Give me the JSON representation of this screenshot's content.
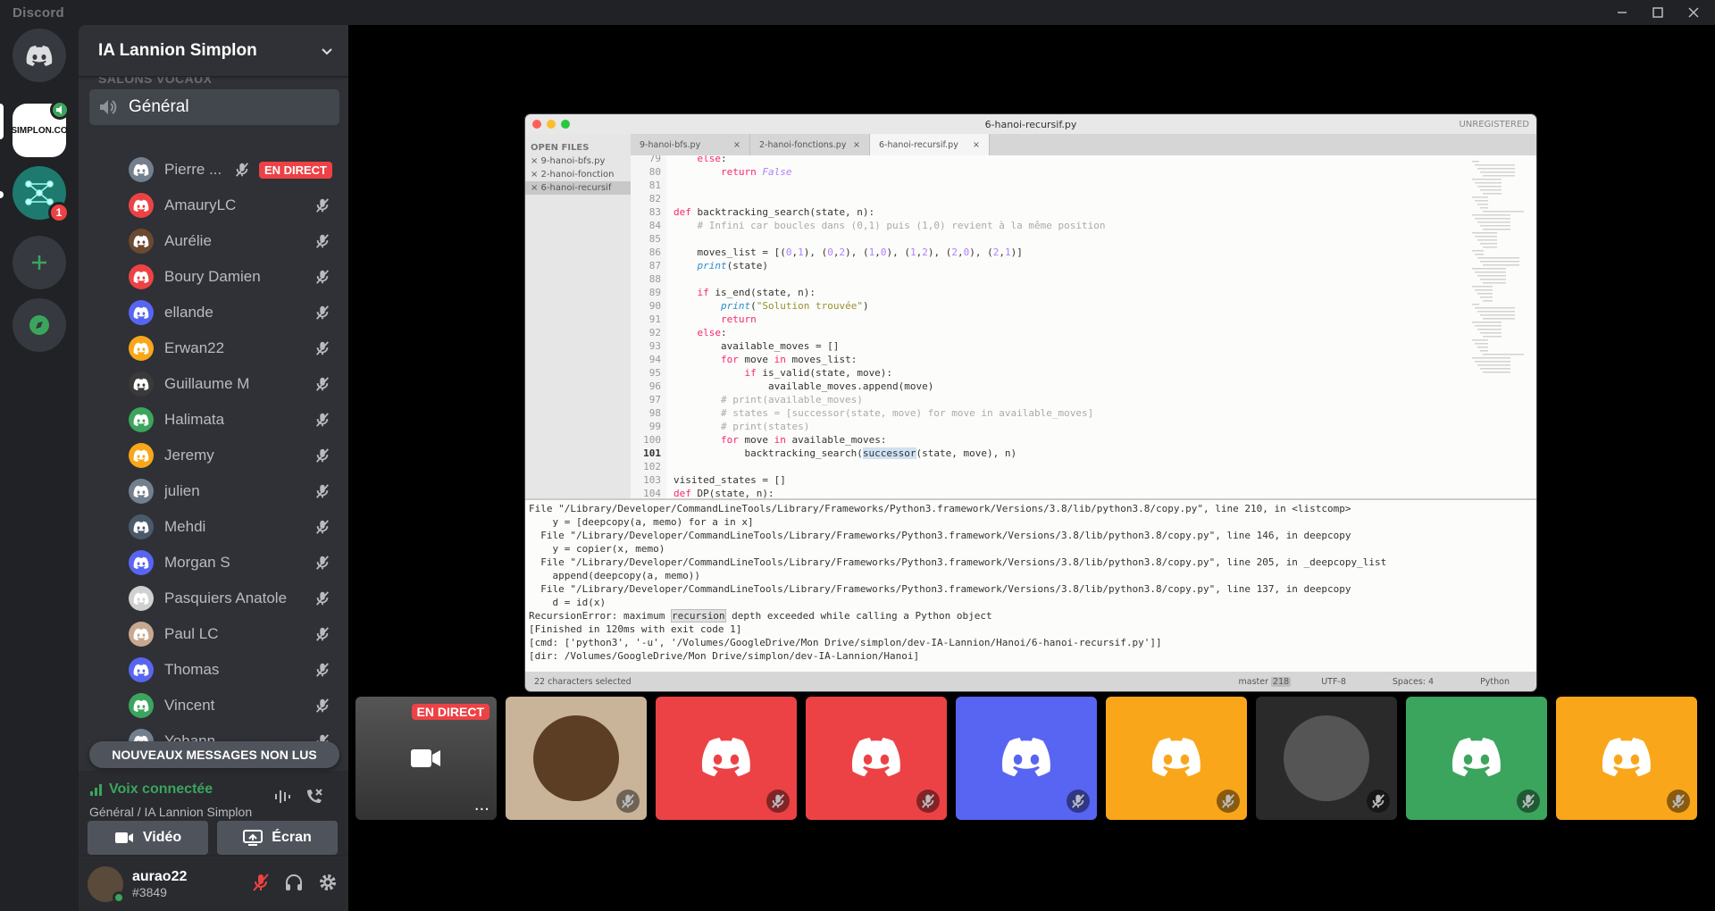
{
  "app": {
    "title": "Discord"
  },
  "server": {
    "name": "IA Lannion Simplon",
    "category": "SALONS VOCAUX"
  },
  "voice_channel": {
    "name": "Général"
  },
  "members": [
    {
      "name": "Pierre ...",
      "color": "#747f8d",
      "live": true
    },
    {
      "name": "AmauryLC",
      "color": "#ed4245"
    },
    {
      "name": "Aurélie",
      "color": "#6b4a30"
    },
    {
      "name": "Boury Damien",
      "color": "#ed4245"
    },
    {
      "name": "ellande",
      "color": "#5865f2"
    },
    {
      "name": "Erwan22",
      "color": "#faa61a"
    },
    {
      "name": "Guillaume M",
      "color": "#3a3a3a"
    },
    {
      "name": "Halimata",
      "color": "#3ba55d"
    },
    {
      "name": "Jeremy",
      "color": "#faa61a"
    },
    {
      "name": "julien",
      "color": "#747f8d"
    },
    {
      "name": "Mehdi",
      "color": "#4a5a6a"
    },
    {
      "name": "Morgan S",
      "color": "#5865f2"
    },
    {
      "name": "Pasquiers Anatole",
      "color": "#d0d0d0"
    },
    {
      "name": "Paul LC",
      "color": "#c8a890"
    },
    {
      "name": "Thomas",
      "color": "#5865f2"
    },
    {
      "name": "Vincent",
      "color": "#3ba55d"
    },
    {
      "name": "Yohann",
      "color": "#747f8d"
    }
  ],
  "live_label": "EN DIRECT",
  "unread_banner": "NOUVEAUX MESSAGES NON LUS",
  "voice_status": {
    "title": "Voix connectée",
    "subtitle": "Général / IA Lannion Simplon",
    "video_label": "Vidéo",
    "screen_label": "Écran"
  },
  "user": {
    "name": "aurao22",
    "tag": "#3849"
  },
  "guild_badge": "1",
  "simplon_label": "SIMPLON.CO",
  "editor": {
    "filename": "6-hanoi-recursif.py",
    "unregistered": "UNREGISTERED",
    "open_files_label": "OPEN FILES",
    "open_files": [
      "9-hanoi-bfs.py",
      "2-hanoi-fonction",
      "6-hanoi-recursif"
    ],
    "tabs": [
      "9-hanoi-bfs.py",
      "2-hanoi-fonctions.py",
      "6-hanoi-recursif.py"
    ],
    "lines": [
      {
        "n": "79",
        "t": "    else:"
      },
      {
        "n": "80",
        "t": "        return False"
      },
      {
        "n": "81",
        "t": ""
      },
      {
        "n": "82",
        "t": ""
      },
      {
        "n": "83",
        "t": "def backtracking_search(state, n):"
      },
      {
        "n": "84",
        "t": "    # Infini car boucles dans (0,1) puis (1,0) revient à la même position"
      },
      {
        "n": "85",
        "t": ""
      },
      {
        "n": "86",
        "t": "    moves_list = [(0,1), (0,2), (1,0), (1,2), (2,0), (2,1)]"
      },
      {
        "n": "87",
        "t": "    print(state)"
      },
      {
        "n": "88",
        "t": ""
      },
      {
        "n": "89",
        "t": "    if is_end(state, n):"
      },
      {
        "n": "90",
        "t": "        print(\"Solution trouvée\")"
      },
      {
        "n": "91",
        "t": "        return"
      },
      {
        "n": "92",
        "t": "    else:"
      },
      {
        "n": "93",
        "t": "        available_moves = []"
      },
      {
        "n": "94",
        "t": "        for move in moves_list:"
      },
      {
        "n": "95",
        "t": "            if is_valid(state, move):"
      },
      {
        "n": "96",
        "t": "                available_moves.append(move)"
      },
      {
        "n": "97",
        "t": "        # print(available_moves)"
      },
      {
        "n": "98",
        "t": "        # states = [successor(state, move) for move in available_moves]"
      },
      {
        "n": "99",
        "t": "        # print(states)"
      },
      {
        "n": "100",
        "t": "        for move in available_moves:"
      },
      {
        "n": "101",
        "t": "            backtracking_search(successor(state, move), n)"
      },
      {
        "n": "102",
        "t": ""
      },
      {
        "n": "103",
        "t": "visited_states = []"
      },
      {
        "n": "104",
        "t": "def DP(state, n):"
      }
    ],
    "console": [
      "File \"/Library/Developer/CommandLineTools/Library/Frameworks/Python3.framework/Versions/3.8/lib/python3.8/copy.py\", line 210, in <listcomp>",
      "    y = [deepcopy(a, memo) for a in x]",
      "  File \"/Library/Developer/CommandLineTools/Library/Frameworks/Python3.framework/Versions/3.8/lib/python3.8/copy.py\", line 146, in deepcopy",
      "    y = copier(x, memo)",
      "  File \"/Library/Developer/CommandLineTools/Library/Frameworks/Python3.framework/Versions/3.8/lib/python3.8/copy.py\", line 205, in _deepcopy_list",
      "    append(deepcopy(a, memo))",
      "  File \"/Library/Developer/CommandLineTools/Library/Frameworks/Python3.framework/Versions/3.8/lib/python3.8/copy.py\", line 137, in deepcopy",
      "    d = id(x)",
      "RecursionError: maximum recursion depth exceeded while calling a Python object",
      "[Finished in 120ms with exit code 1]",
      "[cmd: ['python3', '-u', '/Volumes/GoogleDrive/Mon Drive/simplon/dev-IA-Lannion/Hanoi/6-hanoi-recursif.py']]",
      "[dir: /Volumes/GoogleDrive/Mon Drive/simplon/dev-IA-Lannion/Hanoi]"
    ],
    "status_left": "22 characters selected",
    "status_branch": "master",
    "status_branch_count": "218",
    "status_encoding": "UTF-8",
    "status_spaces": "Spaces: 4",
    "status_lang": "Python"
  },
  "tiles": [
    {
      "kind": "stream",
      "label": "EN DIRECT",
      "color": "#2f3136"
    },
    {
      "kind": "avatar",
      "color": "#c9b49a"
    },
    {
      "kind": "discord",
      "color": "#ed4245"
    },
    {
      "kind": "discord",
      "color": "#ed4245"
    },
    {
      "kind": "discord",
      "color": "#5865f2"
    },
    {
      "kind": "discord",
      "color": "#faa61a"
    },
    {
      "kind": "avatar",
      "color": "#2a2a2a"
    },
    {
      "kind": "discord",
      "color": "#3ba55d"
    },
    {
      "kind": "discord",
      "color": "#faa61a"
    }
  ]
}
